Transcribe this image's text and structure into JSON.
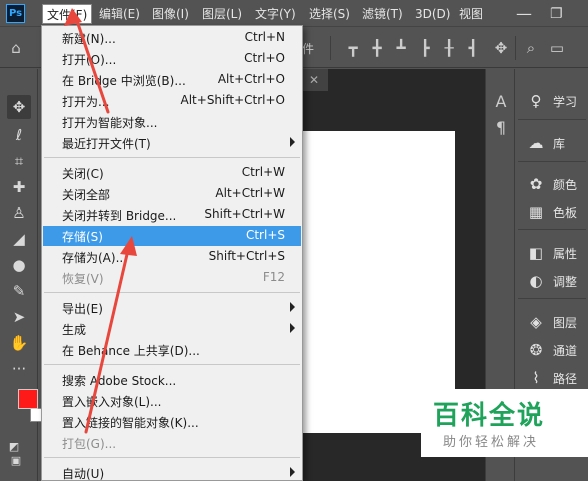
{
  "app": {
    "logo": "Ps"
  },
  "menubar": {
    "items": [
      "文件(F)",
      "编辑(E)",
      "图像(I)",
      "图层(L)",
      "文字(Y)",
      "选择(S)",
      "滤镜(T)",
      "3D(D)",
      "视图"
    ],
    "active_index": 0
  },
  "options_bar": {
    "label": "件"
  },
  "file_menu": {
    "items": [
      {
        "label": "新建(N)...",
        "shortcut": "Ctrl+N"
      },
      {
        "label": "打开(O)...",
        "shortcut": "Ctrl+O"
      },
      {
        "label": "在 Bridge 中浏览(B)...",
        "shortcut": "Alt+Ctrl+O"
      },
      {
        "label": "打开为...",
        "shortcut": "Alt+Shift+Ctrl+O"
      },
      {
        "label": "打开为智能对象...",
        "shortcut": ""
      },
      {
        "label": "最近打开文件(T)",
        "shortcut": "",
        "submenu": true
      },
      {
        "label": "关闭(C)",
        "shortcut": "Ctrl+W"
      },
      {
        "label": "关闭全部",
        "shortcut": "Alt+Ctrl+W"
      },
      {
        "label": "关闭并转到 Bridge...",
        "shortcut": "Shift+Ctrl+W"
      },
      {
        "label": "存储(S)",
        "shortcut": "Ctrl+S",
        "highlighted": true
      },
      {
        "label": "存储为(A)...",
        "shortcut": "Shift+Ctrl+S"
      },
      {
        "label": "恢复(V)",
        "shortcut": "F12",
        "disabled": true
      },
      {
        "label": "导出(E)",
        "shortcut": "",
        "submenu": true
      },
      {
        "label": "生成",
        "shortcut": "",
        "submenu": true
      },
      {
        "label": "在 Behance 上共享(D)...",
        "shortcut": ""
      },
      {
        "label": "搜索 Adobe Stock...",
        "shortcut": ""
      },
      {
        "label": "置入嵌入对象(L)...",
        "shortcut": ""
      },
      {
        "label": "置入链接的智能对象(K)...",
        "shortcut": ""
      },
      {
        "label": "打包(G)...",
        "shortcut": "",
        "disabled": true
      },
      {
        "label": "自动(U)",
        "shortcut": "",
        "submenu": true
      }
    ]
  },
  "right_panel": {
    "items": [
      "学习",
      "库",
      "颜色",
      "色板",
      "属性",
      "调整",
      "图层",
      "通道",
      "路径"
    ]
  },
  "colors": {
    "foreground": "#ff1a1a",
    "background": "#ffffff",
    "highlight": "#3c9ae8",
    "annotation": "#e8473d"
  },
  "watermark": {
    "title": "百科全说",
    "subtitle": "助你轻松解决"
  }
}
